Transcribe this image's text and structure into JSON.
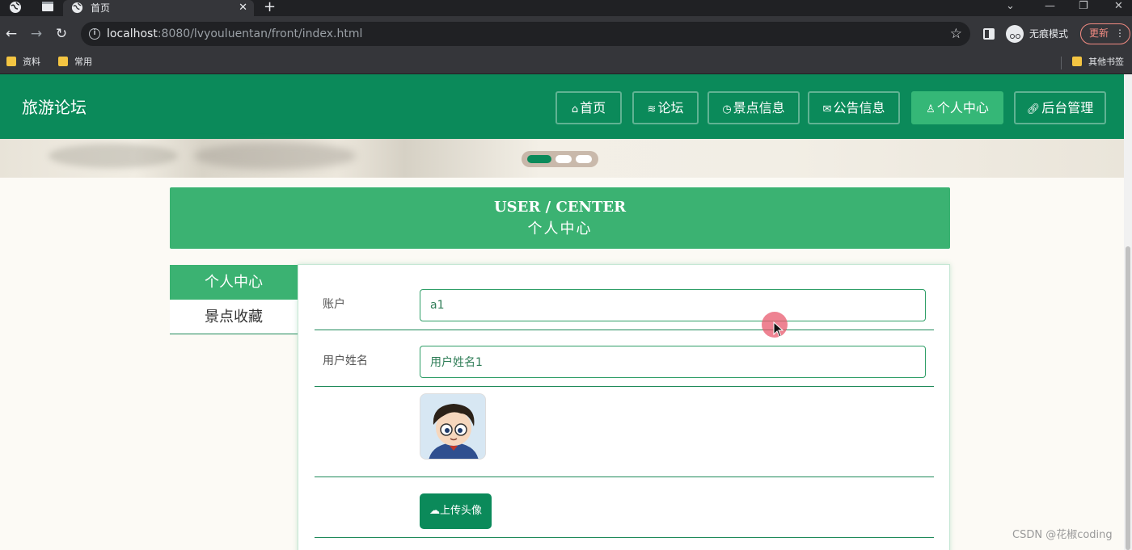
{
  "browser": {
    "tab_title": "首页",
    "url_host": "localhost",
    "url_rest": ":8080/lvyouluentan/front/index.html",
    "incognito_label": "无痕模式",
    "update_label": "更新",
    "bookmarks": [
      "资料",
      "常用"
    ],
    "other_bookmarks": "其他书签"
  },
  "site": {
    "title": "旅游论坛",
    "nav": [
      {
        "label": "首页",
        "icon": "home-icon",
        "active": false
      },
      {
        "label": "论坛",
        "icon": "layers-icon",
        "active": false
      },
      {
        "label": "景点信息",
        "icon": "clock-icon",
        "active": false
      },
      {
        "label": "公告信息",
        "icon": "mail-icon",
        "active": false
      },
      {
        "label": "个人中心",
        "icon": "user-icon",
        "active": true
      },
      {
        "label": "后台管理",
        "icon": "link-icon",
        "active": false
      }
    ]
  },
  "carousel": {
    "slides": 3,
    "active_index": 0
  },
  "user_center": {
    "title_en": "USER / CENTER",
    "title_cn": "个人中心"
  },
  "side_menu": [
    {
      "label": "个人中心",
      "active": true
    },
    {
      "label": "景点收藏",
      "active": false
    }
  ],
  "form": {
    "account_label": "账户",
    "account_value": "a1",
    "name_label": "用户姓名",
    "name_value": "用户姓名1",
    "upload_label": "上传头像"
  },
  "colors": {
    "header_green": "#0b8a5a",
    "accent_green": "#3bb272",
    "nav_active": "#35b777"
  },
  "watermark": "CSDN @花椒coding"
}
